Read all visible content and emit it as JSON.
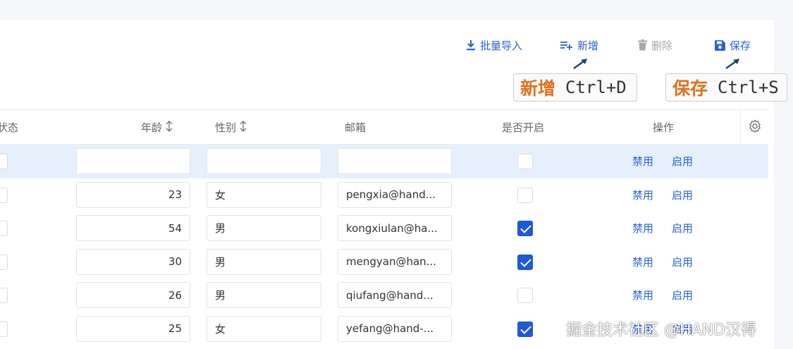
{
  "toolbar": {
    "import_label": "批量导入",
    "add_label": "新增",
    "delete_label": "删除",
    "save_label": "保存"
  },
  "hints": {
    "add": {
      "action": "新增",
      "keys": "Ctrl+D"
    },
    "save": {
      "action": "保存",
      "keys": "Ctrl+S"
    }
  },
  "table": {
    "columns": {
      "status": "状态",
      "age": "年龄",
      "gender": "性别",
      "email": "邮箱",
      "enabled": "是否开启",
      "actions": "操作"
    },
    "action_disable": "禁用",
    "action_enable": "启用",
    "rows": [
      {
        "age": "",
        "gender": "",
        "email": "",
        "enabled": false,
        "selected": true
      },
      {
        "age": "23",
        "gender": "女",
        "email": "pengxia@hand...",
        "enabled": false
      },
      {
        "age": "54",
        "gender": "男",
        "email": "kongxiulan@ha...",
        "enabled": true
      },
      {
        "age": "30",
        "gender": "男",
        "email": "mengyan@han...",
        "enabled": true
      },
      {
        "age": "26",
        "gender": "男",
        "email": "qiufang@hand...",
        "enabled": false
      },
      {
        "age": "25",
        "gender": "女",
        "email": "yefang@hand-...",
        "enabled": true
      }
    ]
  },
  "watermark": "掘金技术社区 @HAND汉得",
  "colors": {
    "accent": "#2a63d8",
    "hint_text": "#e2711d",
    "selected_row": "#e6f0fd"
  }
}
